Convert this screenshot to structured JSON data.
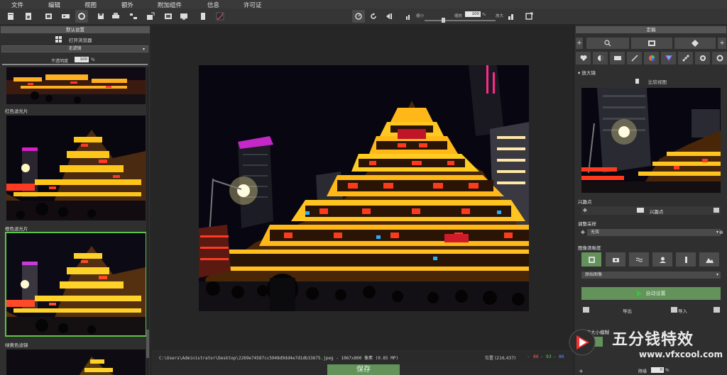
{
  "menu": [
    "文件",
    "编辑",
    "视图",
    "额外",
    "附加组件",
    "信息",
    "许可证"
  ],
  "zoom": {
    "min_label": "缩小",
    "label": "缩放",
    "value": "100",
    "unit": "%",
    "max_label": "放大"
  },
  "left": {
    "header": "默认设置",
    "open_browser": "打开浏览器",
    "filter_select": "无滤镜",
    "opacity_label": "不透明度",
    "opacity_value": "100",
    "opacity_unit": "%",
    "thumbs": [
      {
        "label": "红色滤光片"
      },
      {
        "label": "橙色滤光片"
      },
      {
        "label": "绿黄色滤镜"
      }
    ]
  },
  "status": {
    "path": "C:\\Users\\Administrator\\Desktop\\2269e74587cc5048d9dd4e7d1db33675.jpeg - 1067x800 像素 (0.85 MP)",
    "pos_label": "位置 (216,437)",
    "r": "86",
    "g": "93",
    "b": "86"
  },
  "save_label": "保存",
  "right": {
    "header": "定稿",
    "magnifier": "放大镜",
    "compare": "比较视图",
    "poi_section": "兴趣点",
    "poi_label": "兴趣点",
    "resample_section": "调整采样",
    "resample_value": "无效",
    "sharpen_section": "图像清晰度",
    "original_select": "原始图像",
    "auto_label": "自动设置",
    "export_label": "导出",
    "import_label": "导入",
    "size_label": "调整大小模糊",
    "noise_label": "降噪",
    "noise_value": "0",
    "noise_unit": "%"
  },
  "watermark": {
    "text": "五分钱特效",
    "url": "www.vfxcool.com"
  }
}
